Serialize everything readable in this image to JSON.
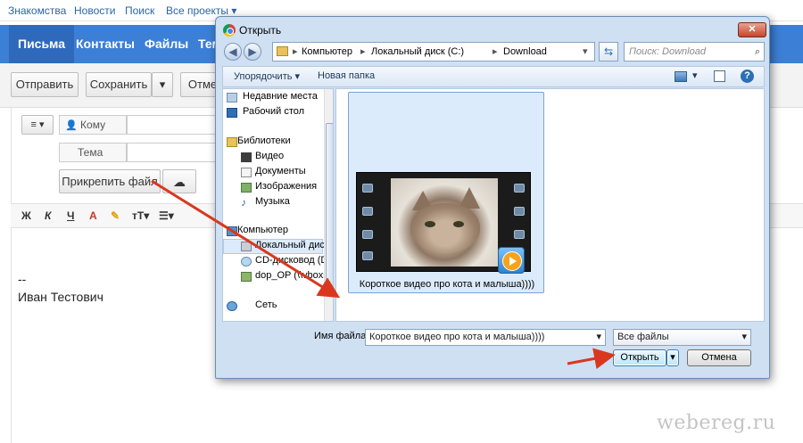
{
  "topnav": {
    "links": [
      "Знакомства",
      "Новости",
      "Поиск",
      "Все проекты ▾"
    ]
  },
  "tabs": [
    "Письма",
    "Контакты",
    "Файлы",
    "Тем"
  ],
  "toolbar": {
    "send": "Отправить",
    "save": "Сохранить",
    "more": "Отме"
  },
  "compose": {
    "format_btn": "≡ ▾",
    "to_label": "Кому",
    "subject_label": "Тема",
    "attach": "Прикрепить файл",
    "signature_dash": "--",
    "signature_name": "Иван Тестович"
  },
  "format_toolbar": [
    "Ж",
    "К",
    "Ч",
    "A",
    "✎",
    "тТ▾",
    "☰▾"
  ],
  "dialog": {
    "title": "Открыть",
    "close": "✕",
    "breadcrumb": [
      "Компьютер",
      "Локальный диск (C:)",
      "Download"
    ],
    "search_placeholder": "Поиск: Download",
    "organize": "Упорядочить ▾",
    "new_folder": "Новая папка",
    "nav_items": [
      "Недавние места",
      "Рабочий стол",
      "Библиотеки",
      "Видео",
      "Документы",
      "Изображения",
      "Музыка",
      "Компьютер",
      "Локальный диск",
      "CD-дисковод (D:",
      "dop_OP (\\\\vboxs",
      "Сеть"
    ],
    "file_caption": "Короткое видео про кота и малыша))))",
    "filename_label": "Имя файла:",
    "filename_value": "Короткое видео про кота и малыша))))",
    "filetype_value": "Все файлы",
    "open": "Открыть",
    "cancel": "Отмена"
  },
  "watermark": "webereg.ru",
  "colors": {
    "accent": "#3c7fd6",
    "link": "#2965a7",
    "annotation_arrow": "#d9381e"
  }
}
